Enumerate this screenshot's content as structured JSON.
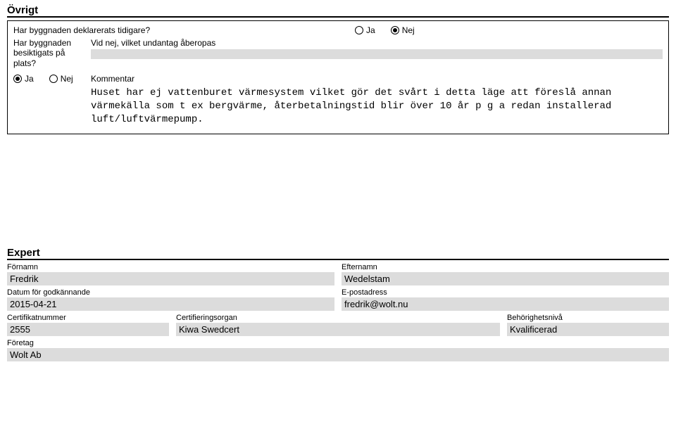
{
  "ovrigt": {
    "heading": "Övrigt",
    "q_deklarerats": "Har byggnaden deklarerats tidigare?",
    "ja": "Ja",
    "nej": "Nej",
    "q_besiktigats": "Har byggnaden besiktigats på plats?",
    "undantag_label": "Vid nej, vilket undantag åberopas",
    "kommentar_label": "Kommentar",
    "kommentar_text": "Huset har ej vattenburet värmesystem vilket gör det svårt i detta läge att föreslå annan värmekälla som t ex bergvärme, återbetalningstid blir över 10 år p g a redan installerad luft/luftvärmepump."
  },
  "expert": {
    "heading": "Expert",
    "fornamn_label": "Förnamn",
    "fornamn": "Fredrik",
    "efternamn_label": "Efternamn",
    "efternamn": "Wedelstam",
    "datum_label": "Datum för godkännande",
    "datum": "2015-04-21",
    "epost_label": "E-postadress",
    "epost": "fredrik@wolt.nu",
    "cert_label": "Certifikatnummer",
    "cert": "2555",
    "organ_label": "Certifieringsorgan",
    "organ": "Kiwa Swedcert",
    "niva_label": "Behörighetsnivå",
    "niva": "Kvalificerad",
    "foretag_label": "Företag",
    "foretag": "Wolt Ab"
  }
}
